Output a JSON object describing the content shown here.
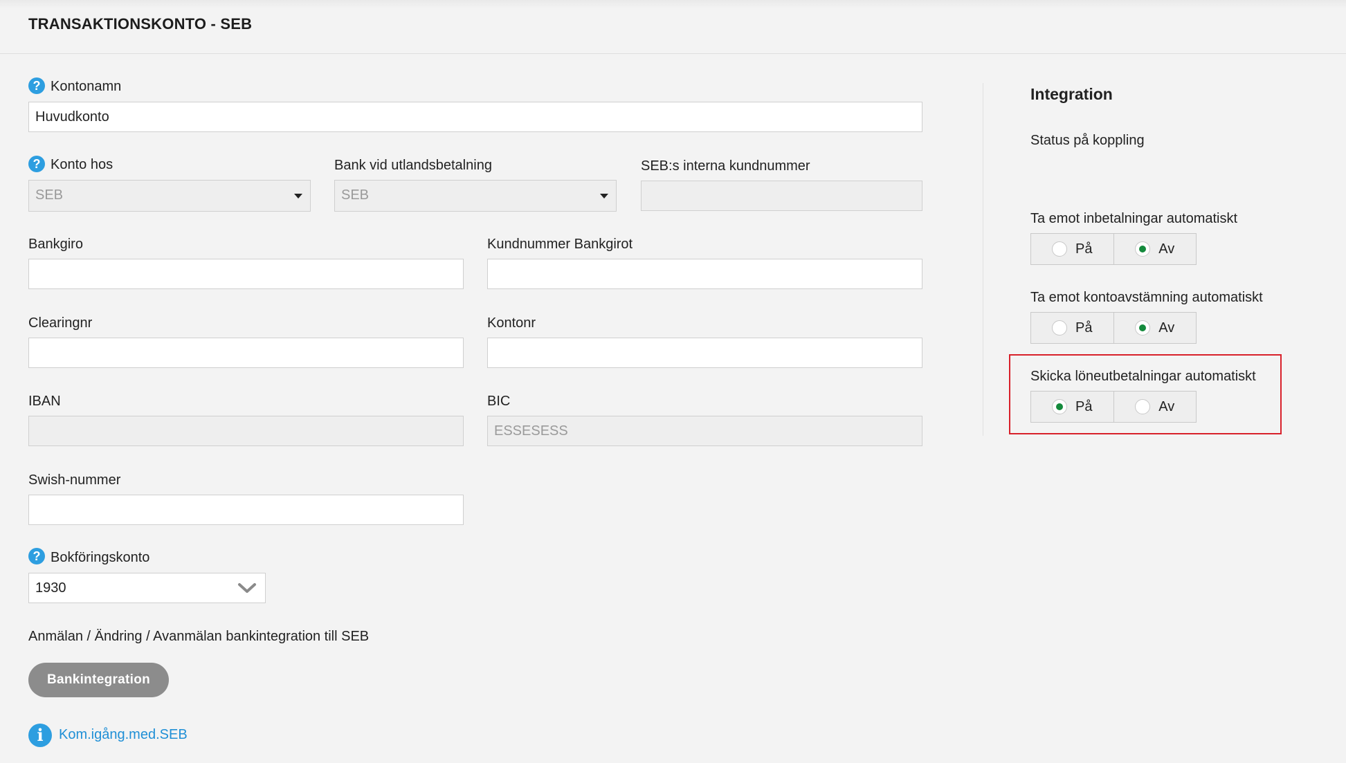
{
  "header": {
    "title": "TRANSAKTIONSKONTO - SEB"
  },
  "form": {
    "kontonamn": {
      "label": "Kontonamn",
      "value": "Huvudkonto"
    },
    "konto_hos": {
      "label": "Konto hos",
      "value": "SEB"
    },
    "bank_utland": {
      "label": "Bank vid utlandsbetalning",
      "value": "SEB"
    },
    "seb_kundnummer": {
      "label": "SEB:s interna kundnummer",
      "value": ""
    },
    "bankgiro": {
      "label": "Bankgiro",
      "value": ""
    },
    "kundnummer_bankgirot": {
      "label": "Kundnummer Bankgirot",
      "value": ""
    },
    "clearingnr": {
      "label": "Clearingnr",
      "value": ""
    },
    "kontonr": {
      "label": "Kontonr",
      "value": ""
    },
    "iban": {
      "label": "IBAN",
      "value": ""
    },
    "bic": {
      "label": "BIC",
      "value": "ESSESESS"
    },
    "swish": {
      "label": "Swish-nummer",
      "value": ""
    },
    "bokforingskonto": {
      "label": "Bokföringskonto",
      "value": "1930"
    },
    "integration_note": "Anmälan / Ändring / Avanmälan bankintegration till SEB",
    "button_label": "Bankintegration",
    "link_label": "Kom.igång.med.SEB"
  },
  "integration": {
    "title": "Integration",
    "status_label": "Status på koppling",
    "toggles": [
      {
        "label": "Ta emot inbetalningar automatiskt",
        "on_label": "På",
        "off_label": "Av",
        "selected": "Av"
      },
      {
        "label": "Ta emot kontoavstämning automatiskt",
        "on_label": "På",
        "off_label": "Av",
        "selected": "Av"
      },
      {
        "label": "Skicka löneutbetalningar automatiskt",
        "on_label": "På",
        "off_label": "Av",
        "selected": "På"
      }
    ]
  },
  "colors": {
    "accent": "#2d9ee0",
    "radio_checked": "#148a3c",
    "highlight": "#d8202a",
    "button": "#8c8c8c"
  },
  "icons": [
    "help-icon",
    "caret-down-icon",
    "chevron-down-icon",
    "info-icon"
  ]
}
